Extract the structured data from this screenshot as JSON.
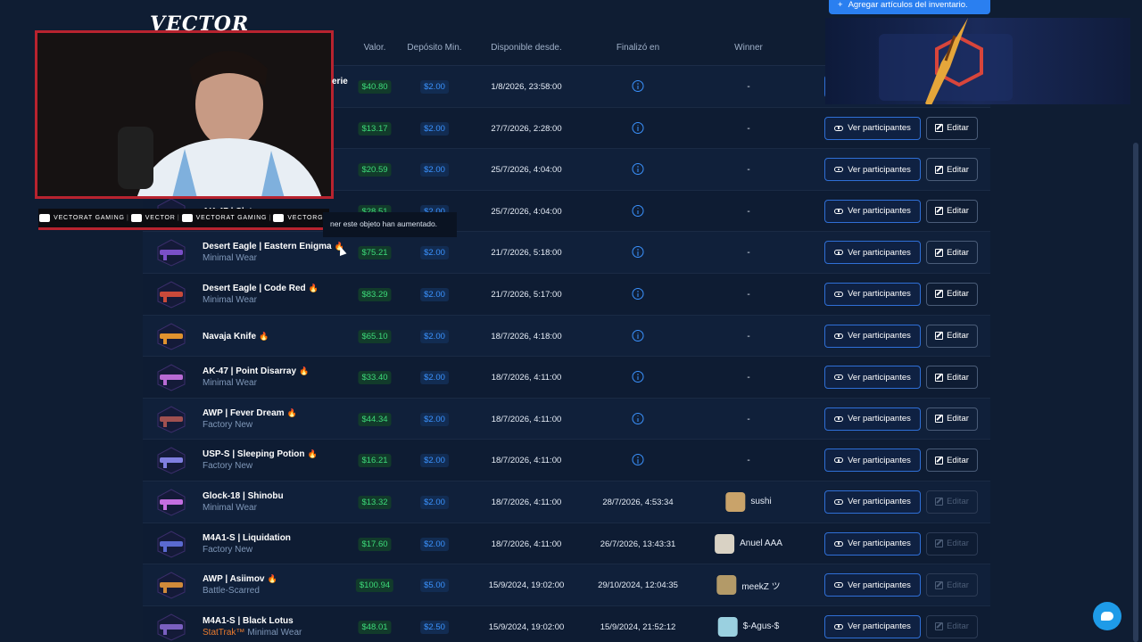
{
  "header": {
    "value": "Valor.",
    "deposit": "Depósito Min.",
    "available": "Disponible desde.",
    "ended": "Finalizó en",
    "winner": "Winner"
  },
  "view_label": "Ver participantes",
  "edit_label": "Editar",
  "add_button": "Agregar artículos del inventario.",
  "tooltip": "ner este objeto han aumentado.",
  "overlay": {
    "logo": "VECTOR",
    "socials": [
      "VECTORAT GAMING",
      "VECTOR",
      "VECTORAT GAMING",
      "VECTORGA"
    ],
    "truncated_name": "erie"
  },
  "colors": {
    "accent": "#3b93ff",
    "value_green": "#3ddc7a",
    "fire": "#ff5a3c",
    "stattrak": "#e87a2e"
  },
  "rows": [
    {
      "name": "",
      "sub": "",
      "value": "$40.80",
      "deposit": "$2.00",
      "available": "1/8/2026, 23:58:00",
      "ended_icon": "info-icon",
      "ended": "",
      "winner": "-",
      "edit_disabled": false,
      "hot": false
    },
    {
      "name": "",
      "sub": "",
      "value": "$13.17",
      "deposit": "$2.00",
      "available": "27/7/2026, 2:28:00",
      "ended_icon": "info-icon",
      "ended": "",
      "winner": "-",
      "edit_disabled": false,
      "hot": false
    },
    {
      "name": "",
      "sub": "",
      "value": "$20.59",
      "deposit": "$2.00",
      "available": "25/7/2026, 4:04:00",
      "ended_icon": "info-icon",
      "ended": "",
      "winner": "-",
      "edit_disabled": false,
      "hot": false
    },
    {
      "name": "AK-47 | Slate",
      "sub": "",
      "value": "$28.51",
      "deposit": "$2.00",
      "available": "25/7/2026, 4:04:00",
      "ended_icon": "info-icon",
      "ended": "",
      "winner": "-",
      "edit_disabled": false,
      "hot": false
    },
    {
      "name": "Desert Eagle | Eastern Enigma",
      "sub": "Minimal Wear",
      "value": "$75.21",
      "deposit": "$2.00",
      "available": "21/7/2026, 5:18:00",
      "ended_icon": "info-icon",
      "ended": "",
      "winner": "-",
      "edit_disabled": false,
      "hot": true
    },
    {
      "name": "Desert Eagle | Code Red",
      "sub": "Minimal Wear",
      "value": "$83.29",
      "deposit": "$2.00",
      "available": "21/7/2026, 5:17:00",
      "ended_icon": "info-icon",
      "ended": "",
      "winner": "-",
      "edit_disabled": false,
      "hot": true
    },
    {
      "name": "Navaja Knife",
      "sub": "",
      "value": "$65.10",
      "deposit": "$2.00",
      "available": "18/7/2026, 4:18:00",
      "ended_icon": "info-icon",
      "ended": "",
      "winner": "-",
      "edit_disabled": false,
      "hot": true
    },
    {
      "name": "AK-47 | Point Disarray",
      "sub": "Minimal Wear",
      "value": "$33.40",
      "deposit": "$2.00",
      "available": "18/7/2026, 4:11:00",
      "ended_icon": "info-icon",
      "ended": "",
      "winner": "-",
      "edit_disabled": false,
      "hot": true
    },
    {
      "name": "AWP | Fever Dream",
      "sub": "Factory New",
      "value": "$44.34",
      "deposit": "$2.00",
      "available": "18/7/2026, 4:11:00",
      "ended_icon": "info-icon",
      "ended": "",
      "winner": "-",
      "edit_disabled": false,
      "hot": true
    },
    {
      "name": "USP-S | Sleeping Potion",
      "sub": "Factory New",
      "value": "$16.21",
      "deposit": "$2.00",
      "available": "18/7/2026, 4:11:00",
      "ended_icon": "info-icon",
      "ended": "",
      "winner": "-",
      "edit_disabled": false,
      "hot": true
    },
    {
      "name": "Glock-18 | Shinobu",
      "sub": "Minimal Wear",
      "value": "$13.32",
      "deposit": "$2.00",
      "available": "18/7/2026, 4:11:00",
      "ended_icon": "",
      "ended": "28/7/2026, 4:53:34",
      "winner": "sushi",
      "winner_color": "#c9a36a",
      "edit_disabled": true,
      "hot": false
    },
    {
      "name": "M4A1-S | Liquidation",
      "sub": "Factory New",
      "value": "$17.60",
      "deposit": "$2.00",
      "available": "18/7/2026, 4:11:00",
      "ended_icon": "",
      "ended": "26/7/2026, 13:43:31",
      "winner": "Anuel AAA",
      "winner_color": "#d9d2c4",
      "edit_disabled": true,
      "hot": false
    },
    {
      "name": "AWP | Asiimov",
      "sub": "Battle-Scarred",
      "value": "$100.94",
      "deposit": "$5.00",
      "available": "15/9/2024, 19:02:00",
      "ended_icon": "",
      "ended": "29/10/2024, 12:04:35",
      "winner": "meekZ ツ",
      "winner_color": "#b39a68",
      "edit_disabled": true,
      "hot": true
    },
    {
      "name": "M4A1-S | Black Lotus",
      "sub": "Minimal Wear",
      "sub_prefix": "StatTrak™",
      "value": "$48.01",
      "deposit": "$2.50",
      "available": "15/9/2024, 19:02:00",
      "ended_icon": "",
      "ended": "15/9/2024, 21:52:12",
      "winner": "$-Agus-$",
      "winner_color": "#9ad0e0",
      "edit_disabled": true,
      "hot": false
    }
  ]
}
